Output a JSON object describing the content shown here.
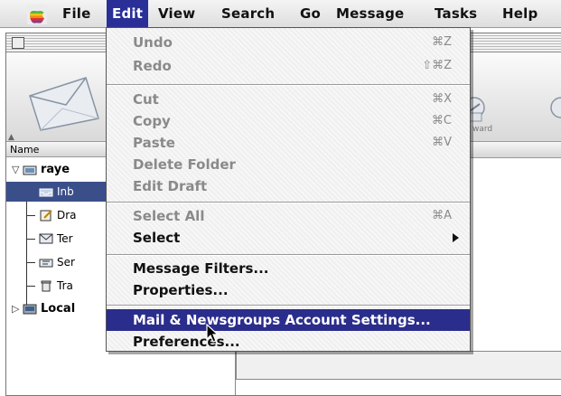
{
  "menubar": {
    "apple_icon": "apple-icon",
    "items": [
      "File",
      "Edit",
      "View",
      "Search",
      "Go",
      "Message",
      "Tasks",
      "Help"
    ],
    "active_item": "Edit",
    "active_color": "#2a2f97"
  },
  "edit_menu": {
    "items": [
      {
        "label": "Undo",
        "shortcut": "⌘Z",
        "enabled": false
      },
      {
        "label": "Redo",
        "shortcut": "⇧⌘Z",
        "enabled": false
      },
      {
        "label": "Cut",
        "shortcut": "⌘X",
        "enabled": false
      },
      {
        "label": "Copy",
        "shortcut": "⌘C",
        "enabled": false
      },
      {
        "label": "Paste",
        "shortcut": "⌘V",
        "enabled": false
      },
      {
        "label": "Delete Folder",
        "shortcut": "",
        "enabled": false
      },
      {
        "label": "Edit Draft",
        "shortcut": "",
        "enabled": false
      },
      {
        "label": "Select All",
        "shortcut": "⌘A",
        "enabled": false
      },
      {
        "label": "Select",
        "shortcut": "",
        "enabled": true,
        "submenu": true
      },
      {
        "label": "Message Filters...",
        "shortcut": "",
        "enabled": true
      },
      {
        "label": "Properties...",
        "shortcut": "",
        "enabled": true
      },
      {
        "label": "Mail & Newsgroups Account Settings...",
        "shortcut": "",
        "enabled": true,
        "highlighted": true
      },
      {
        "label": "Preferences...",
        "shortcut": "",
        "enabled": true
      }
    ]
  },
  "window": {
    "column_header": "Name",
    "toolbar_right_label": "ward",
    "folders": [
      {
        "label": "raye",
        "bold": true,
        "icon": "mail-account-icon"
      },
      {
        "label": "Inb",
        "selected": true,
        "icon": "inbox-icon"
      },
      {
        "label": "Dra",
        "icon": "drafts-icon"
      },
      {
        "label": "Ter",
        "icon": "templates-icon"
      },
      {
        "label": "Ser",
        "icon": "sent-icon"
      },
      {
        "label": "Tra",
        "icon": "trash-icon"
      },
      {
        "label": "Local",
        "bold": true,
        "icon": "local-folders-icon"
      }
    ]
  }
}
